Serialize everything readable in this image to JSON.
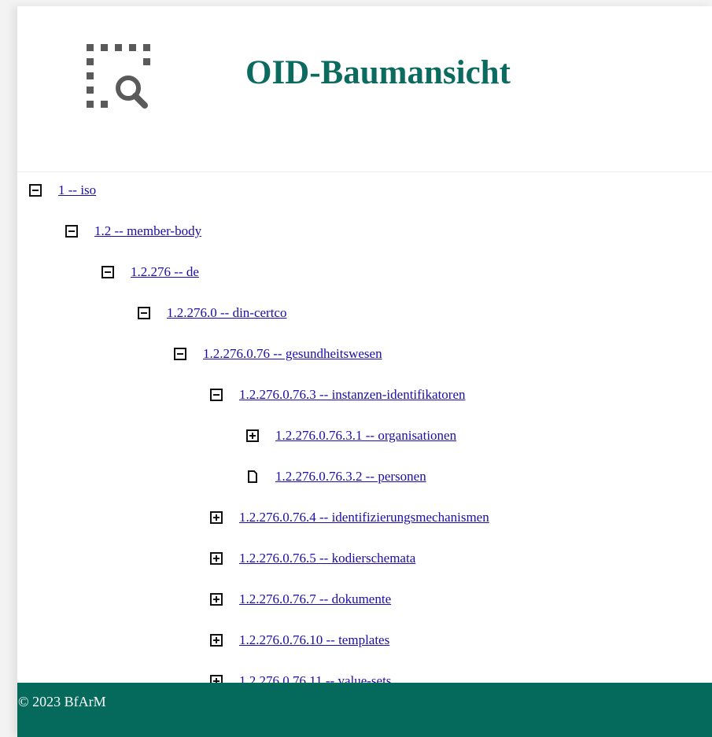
{
  "header": {
    "title": "OID-Baumansicht",
    "logo_icon": "dashed-square-search-icon"
  },
  "tree": {
    "nodes": [
      {
        "label": "1 -- iso",
        "state": "expanded",
        "level": 0
      },
      {
        "label": "1.2 -- member-body",
        "state": "expanded",
        "level": 1
      },
      {
        "label": "1.2.276 -- de",
        "state": "expanded",
        "level": 2
      },
      {
        "label": "1.2.276.0 -- din-certco",
        "state": "expanded",
        "level": 3
      },
      {
        "label": "1.2.276.0.76 -- gesundheitswesen",
        "state": "expanded",
        "level": 4
      },
      {
        "label": "1.2.276.0.76.3 -- instanzen-identifikatoren",
        "state": "expanded",
        "level": 5
      },
      {
        "label": "1.2.276.0.76.3.1 -- organisationen",
        "state": "collapsed",
        "level": 6
      },
      {
        "label": "1.2.276.0.76.3.2 -- personen",
        "state": "leaf",
        "level": 6
      },
      {
        "label": "1.2.276.0.76.4 -- identifizierungsmechanismen",
        "state": "collapsed",
        "level": 5
      },
      {
        "label": "1.2.276.0.76.5 -- kodierschemata",
        "state": "collapsed",
        "level": 5
      },
      {
        "label": "1.2.276.0.76.7 -- dokumente",
        "state": "collapsed",
        "level": 5
      },
      {
        "label": "1.2.276.0.76.10 -- templates",
        "state": "collapsed",
        "level": 5
      },
      {
        "label": "1.2.276.0.76.11 -- value-sets",
        "state": "collapsed",
        "level": 5
      }
    ]
  },
  "footer": {
    "copyright": "© 2023 BfArM"
  },
  "colors": {
    "title": "#0c6b5f",
    "link": "#1a0dab",
    "footer_bg": "#056a5c"
  }
}
